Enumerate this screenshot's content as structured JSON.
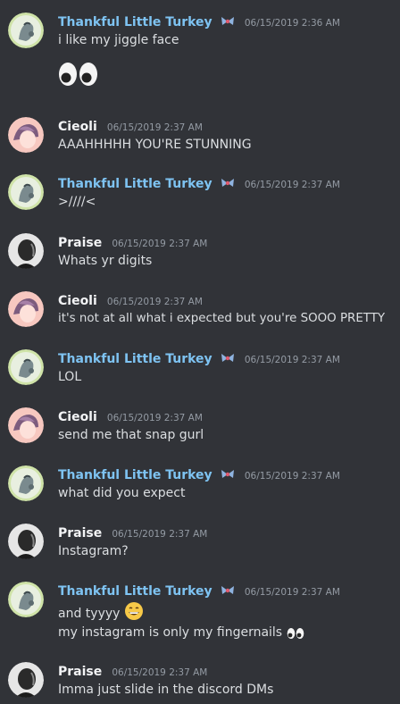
{
  "colors": {
    "background": "#313338",
    "text": "#dbdee1",
    "timestamp": "#949ba4",
    "turkey_name": "#7ec3f2",
    "other_name": "#f2f3f5"
  },
  "users": {
    "turkey": {
      "name": "Thankful Little Turkey",
      "badge_icon": "bow-badge-icon",
      "avatar_icon": "turkey-avatar-icon"
    },
    "cieoli": {
      "name": "Cieoli",
      "avatar_icon": "cieoli-avatar-icon"
    },
    "praise": {
      "name": "Praise",
      "avatar_icon": "praise-avatar-icon"
    }
  },
  "messages": [
    {
      "author": "Thankful Little Turkey",
      "time": "06/15/2019 2:36 AM",
      "lines": [
        "i like my jiggle face"
      ],
      "big_emoji": "eyes-emoji-icon"
    },
    {
      "author": "Cieoli",
      "time": "06/15/2019 2:37 AM",
      "lines": [
        "AAAHHHHH YOU'RE STUNNING"
      ]
    },
    {
      "author": "Thankful Little Turkey",
      "time": "06/15/2019 2:37 AM",
      "lines": [
        ">////<"
      ]
    },
    {
      "author": "Praise",
      "time": "06/15/2019 2:37 AM",
      "lines": [
        "Whats yr digits"
      ]
    },
    {
      "author": "Cieoli",
      "time": "06/15/2019 2:37 AM",
      "lines": [
        "it's not at all what i expected but you're SOOO PRETTY"
      ]
    },
    {
      "author": "Thankful Little Turkey",
      "time": "06/15/2019 2:37 AM",
      "lines": [
        "LOL"
      ]
    },
    {
      "author": "Cieoli",
      "time": "06/15/2019 2:37 AM",
      "lines": [
        "send me that snap gurl"
      ]
    },
    {
      "author": "Thankful Little Turkey",
      "time": "06/15/2019 2:37 AM",
      "lines": [
        "what did you expect"
      ]
    },
    {
      "author": "Praise",
      "time": "06/15/2019 2:37 AM",
      "lines": [
        "Instagram?"
      ]
    },
    {
      "author": "Thankful Little Turkey",
      "time": "06/15/2019 2:37 AM",
      "lines": [
        "and tyyyy",
        "my instagram is only my fingernails"
      ],
      "inline_emoji": [
        "grinning-face-icon",
        "eyes-emoji-icon"
      ]
    },
    {
      "author": "Praise",
      "time": "06/15/2019 2:37 AM",
      "lines": [
        "Imma just slide in the discord DMs"
      ]
    }
  ]
}
